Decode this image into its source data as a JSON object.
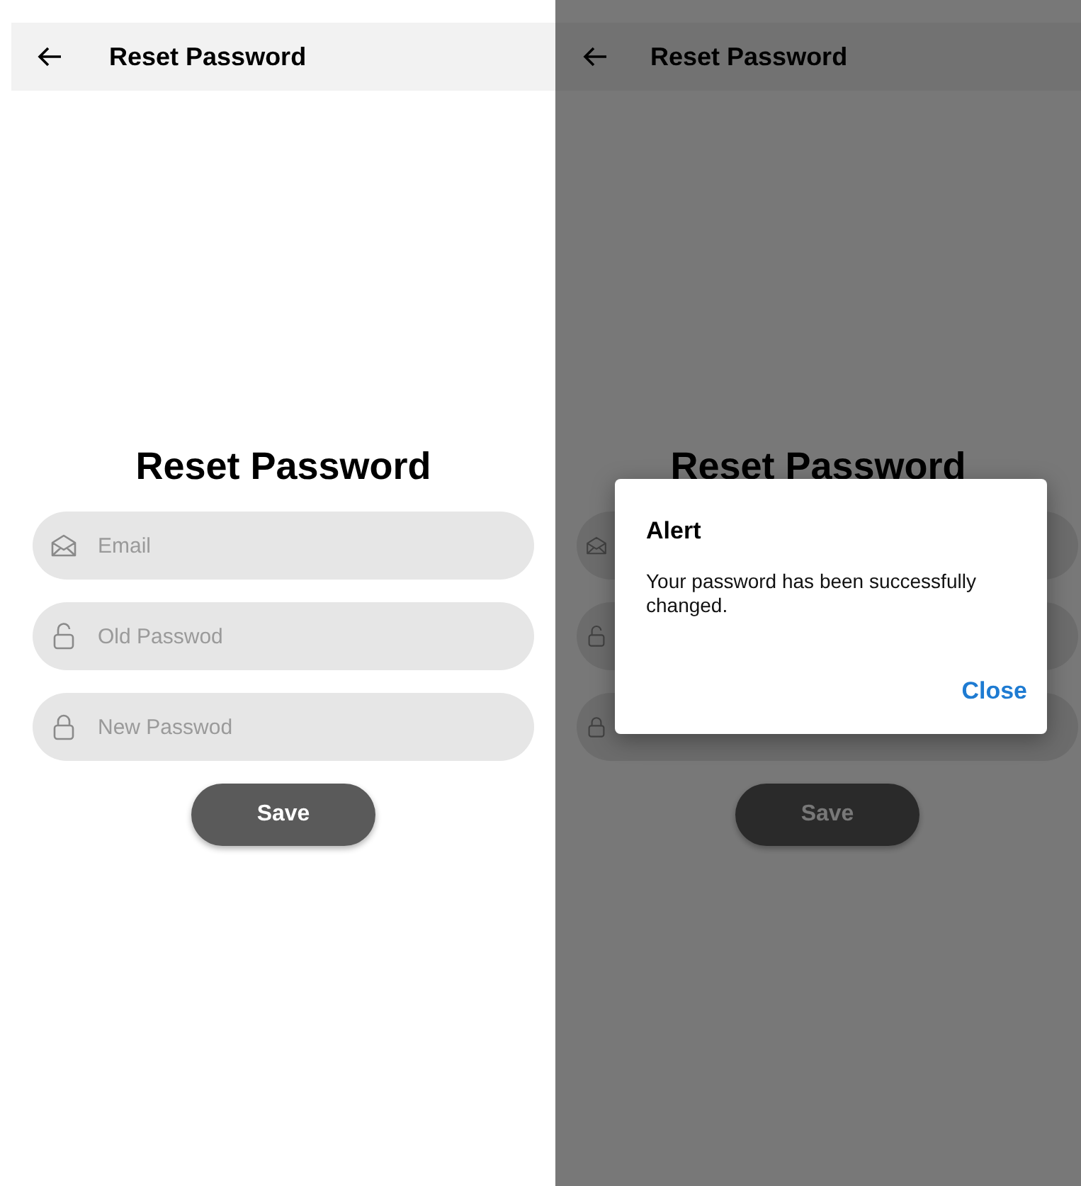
{
  "screens": [
    {
      "app_bar": {
        "title": "Reset Password"
      },
      "heading": "Reset Password",
      "fields": [
        {
          "kind": "email",
          "placeholder": "Email"
        },
        {
          "kind": "current",
          "placeholder": "Old Passwod"
        },
        {
          "kind": "new",
          "placeholder": "New Passwod"
        }
      ],
      "button": "Save"
    },
    {
      "app_bar": {
        "title": "Reset Password"
      },
      "heading": "Reset Password",
      "fields": [
        {
          "kind": "email"
        },
        {
          "kind": "current"
        },
        {
          "kind": "new"
        }
      ],
      "button": "Save",
      "dialog": {
        "title": "Alert",
        "message": "Your password has been successfully changed.",
        "action": "Close"
      }
    }
  ]
}
